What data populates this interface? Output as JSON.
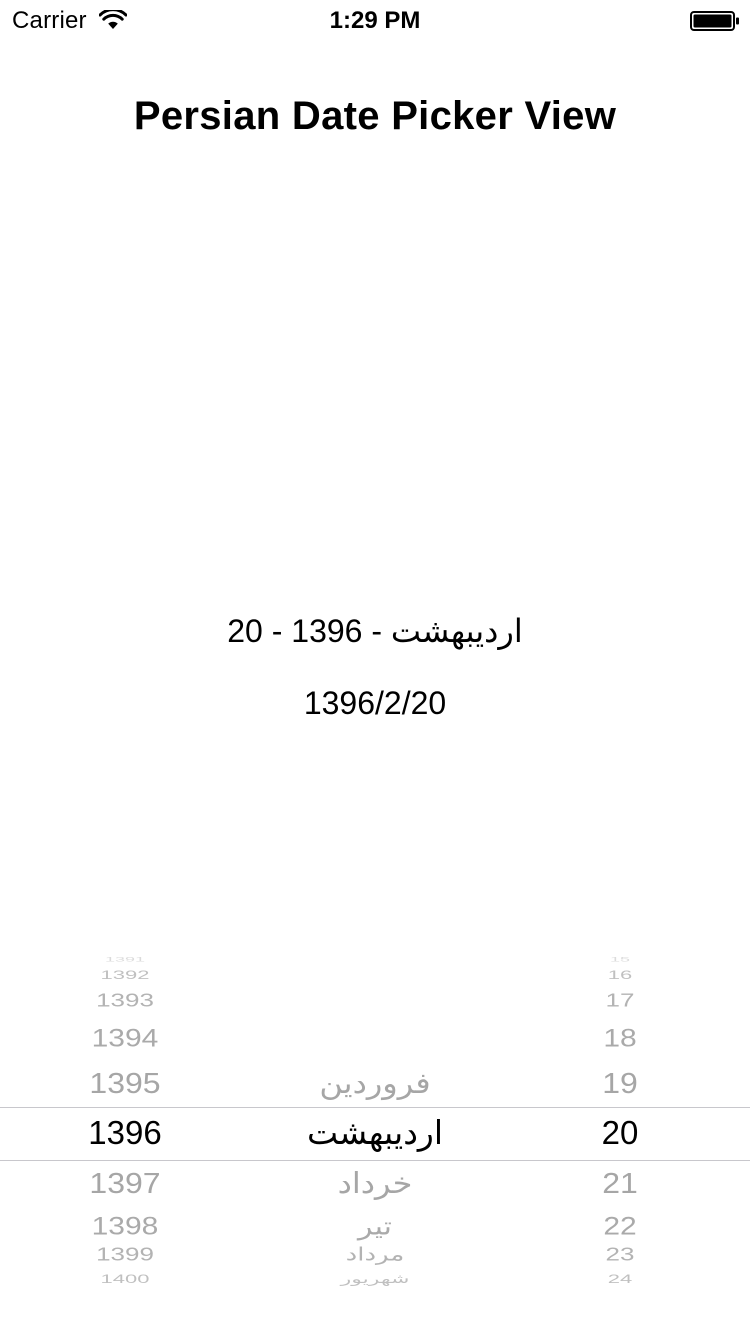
{
  "status_bar": {
    "carrier": "Carrier",
    "time": "1:29 PM",
    "wifi_icon": "wifi-icon",
    "battery_icon": "battery-full-icon"
  },
  "title": "Persian Date Picker View",
  "result": {
    "persian_text": "20 - اردیبهشت - 1396",
    "numeric_text": "1396/2/20"
  },
  "picker": {
    "years": [
      "1391",
      "1392",
      "1393",
      "1394",
      "1395",
      "1396",
      "1397",
      "1398",
      "1399",
      "1400"
    ],
    "months": [
      "فروردین",
      "اردیبهشت",
      "خرداد",
      "تیر",
      "مرداد",
      "شهریور"
    ],
    "days": [
      "15",
      "16",
      "17",
      "18",
      "19",
      "20",
      "21",
      "22",
      "23",
      "24"
    ],
    "selected": {
      "year": "1396",
      "month": "اردیبهشت",
      "day": "20"
    }
  },
  "colors": {
    "background": "#ffffff",
    "text": "#000000",
    "picker_unselected": "#a6a6a6",
    "picker_separator": "#c8c7cc"
  }
}
